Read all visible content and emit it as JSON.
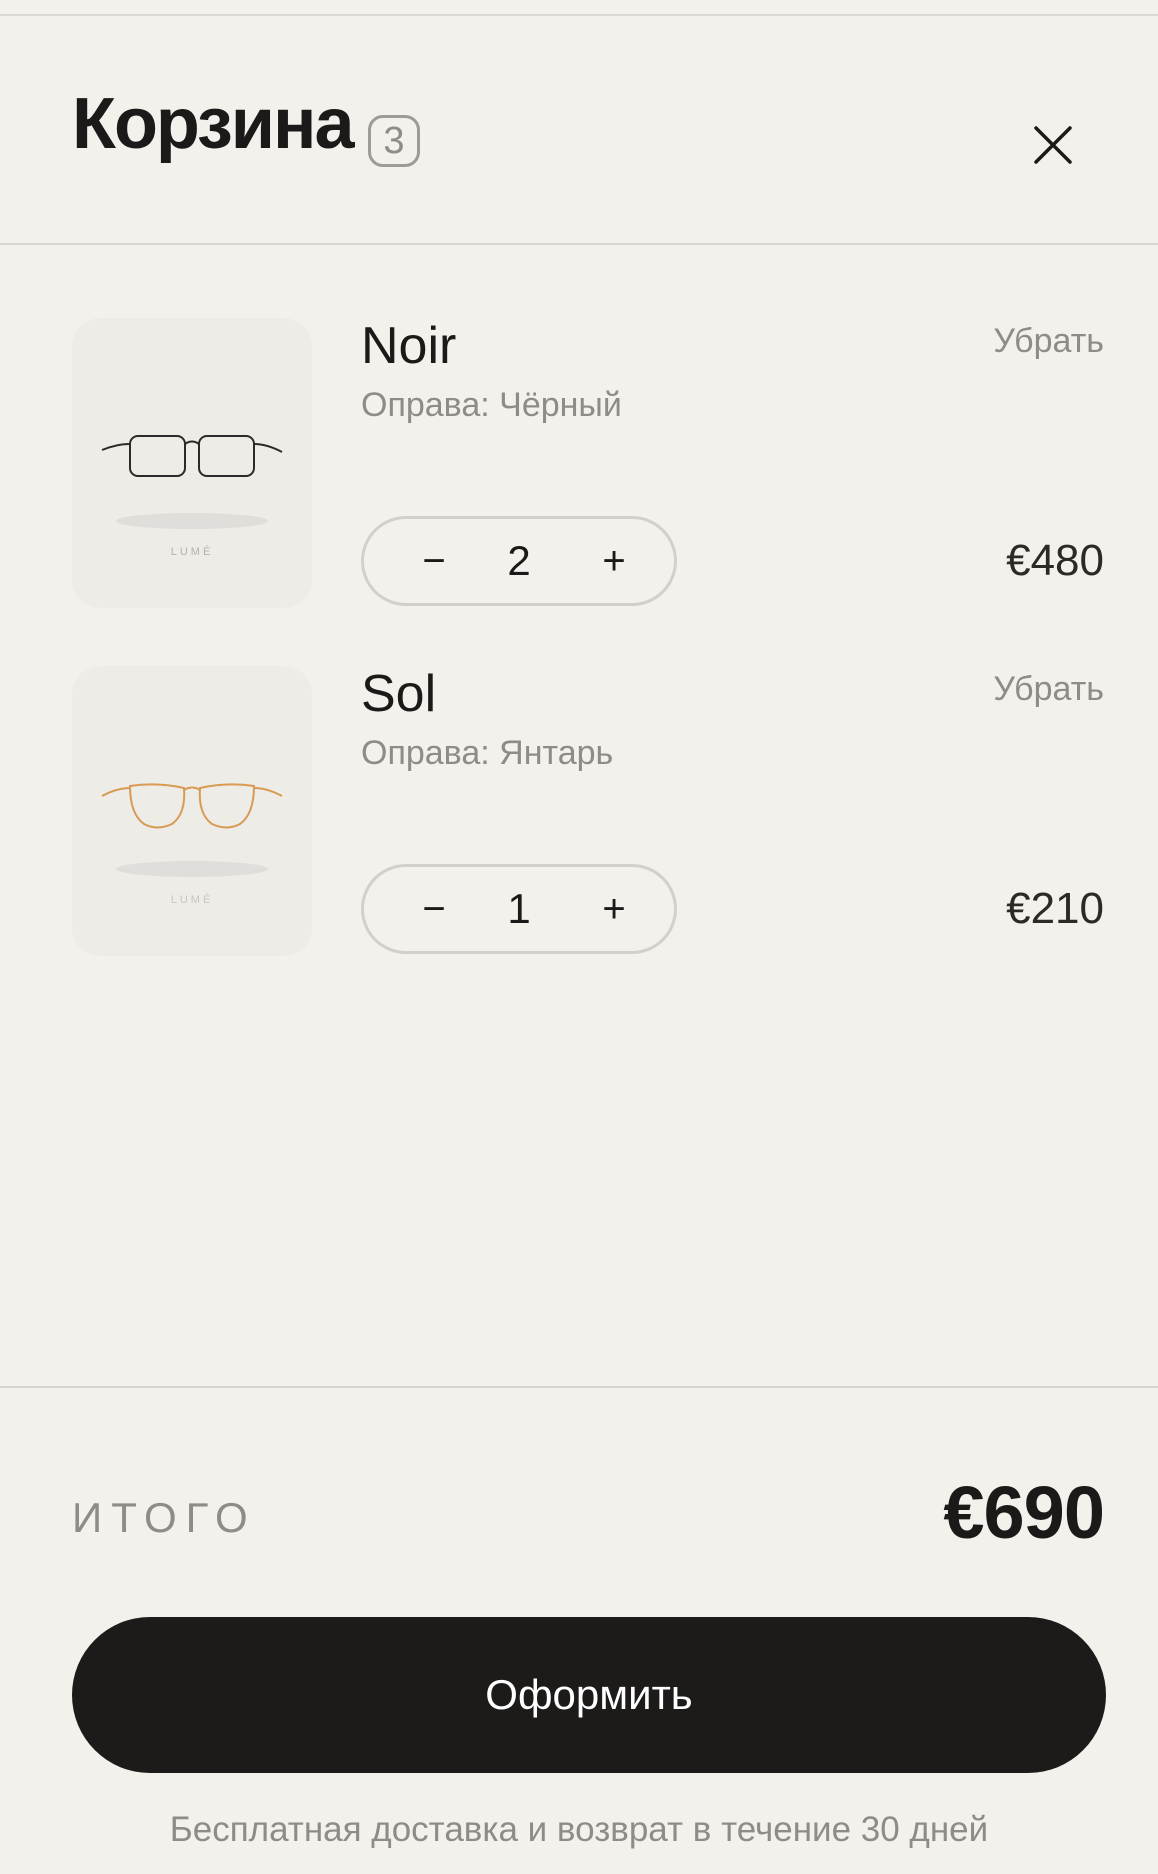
{
  "header": {
    "title": "Корзина",
    "count": "3",
    "close_icon": "close-icon"
  },
  "items": [
    {
      "name": "Noir",
      "option_label": "Оправа:",
      "option_value": "Чёрный",
      "remove_label": "Убрать",
      "quantity": "2",
      "minus_label": "−",
      "plus_label": "+",
      "price": "€480",
      "brand": "LUMÉ",
      "frame_color": "#2a2a2a"
    },
    {
      "name": "Sol",
      "option_label": "Оправа:",
      "option_value": "Янтарь",
      "remove_label": "Убрать",
      "quantity": "1",
      "minus_label": "−",
      "plus_label": "+",
      "price": "€210",
      "brand": "LUMÉ",
      "frame_color": "#d99a55"
    }
  ],
  "summary": {
    "total_label": "ИТОГО",
    "total_value": "€690"
  },
  "checkout": {
    "button_label": "Оформить",
    "note": "Бесплатная доставка и возврат в течение 30 дней"
  },
  "colors": {
    "background": "#f3f1ec",
    "text": "#1b1a18",
    "muted": "#8e8c87",
    "button": "#1c1b19"
  }
}
